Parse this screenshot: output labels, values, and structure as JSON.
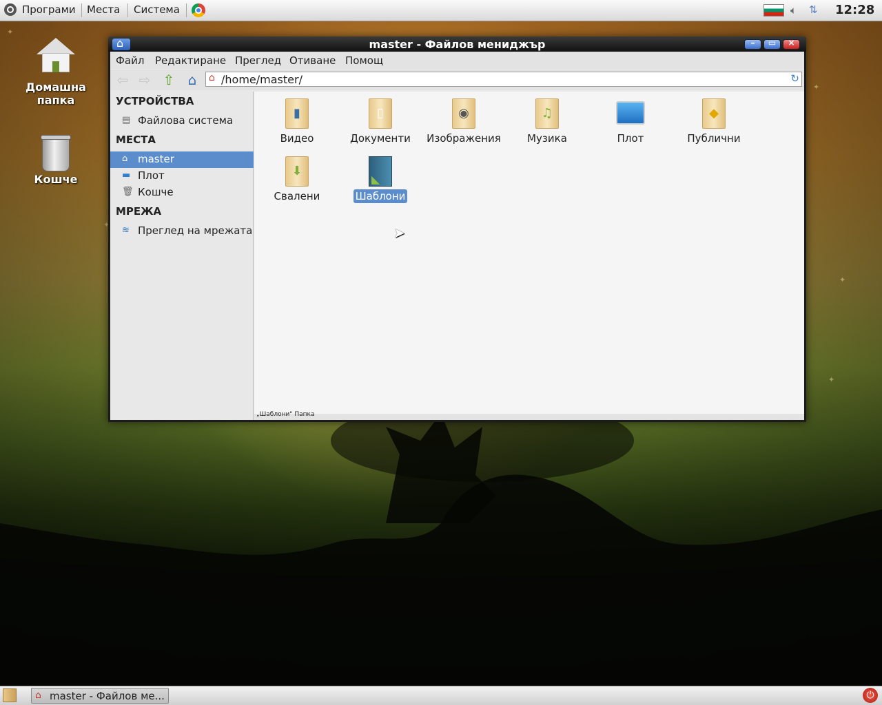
{
  "top_panel": {
    "menus": [
      "Програми",
      "Места",
      "Система"
    ],
    "clock": "12:28",
    "icons": [
      "ubuntu-logo-icon",
      "chrome-icon",
      "bulgarian-flag-icon",
      "volume-icon",
      "network-icon"
    ]
  },
  "desktop": {
    "icons": [
      {
        "label": "Домашна папка",
        "icon": "home-folder-icon"
      },
      {
        "label": "Кошче",
        "icon": "trash-icon"
      }
    ]
  },
  "window": {
    "title": "master - Файлов мениджър",
    "menubar": [
      "Файл",
      "Редактиране",
      "Преглед",
      "Отиване",
      "Помощ"
    ],
    "location": "/home/master/",
    "sidebar": {
      "devices_header": "УСТРОЙСТВА",
      "devices": [
        {
          "label": "Файлова система",
          "icon": "drive-icon"
        }
      ],
      "places_header": "МЕСТА",
      "places": [
        {
          "label": "master",
          "icon": "home-icon",
          "selected": true
        },
        {
          "label": "Плот",
          "icon": "desktop-icon",
          "selected": false
        },
        {
          "label": "Кошче",
          "icon": "trash-icon",
          "selected": false
        }
      ],
      "network_header": "МРЕЖА",
      "network": [
        {
          "label": "Преглед на мрежата",
          "icon": "wifi-icon"
        }
      ]
    },
    "files": [
      {
        "label": "Видео",
        "icon": "video-folder-icon",
        "selected": false
      },
      {
        "label": "Документи",
        "icon": "documents-folder-icon",
        "selected": false
      },
      {
        "label": "Изображения",
        "icon": "pictures-folder-icon",
        "selected": false
      },
      {
        "label": "Музика",
        "icon": "music-folder-icon",
        "selected": false
      },
      {
        "label": "Плот",
        "icon": "desktop-folder-icon",
        "selected": false
      },
      {
        "label": "Публични",
        "icon": "public-folder-icon",
        "selected": false
      },
      {
        "label": "Свалени",
        "icon": "downloads-folder-icon",
        "selected": false
      },
      {
        "label": "Шаблони",
        "icon": "templates-folder-icon",
        "selected": true
      }
    ],
    "status": "„Шаблони\" Папка"
  },
  "taskbar": {
    "task_label": "master - Файлов ме...",
    "icons": [
      "show-desktop-icon",
      "power-icon"
    ]
  },
  "colors": {
    "selection": "#5b8dcd",
    "title_bar": "#1b1b1b"
  }
}
